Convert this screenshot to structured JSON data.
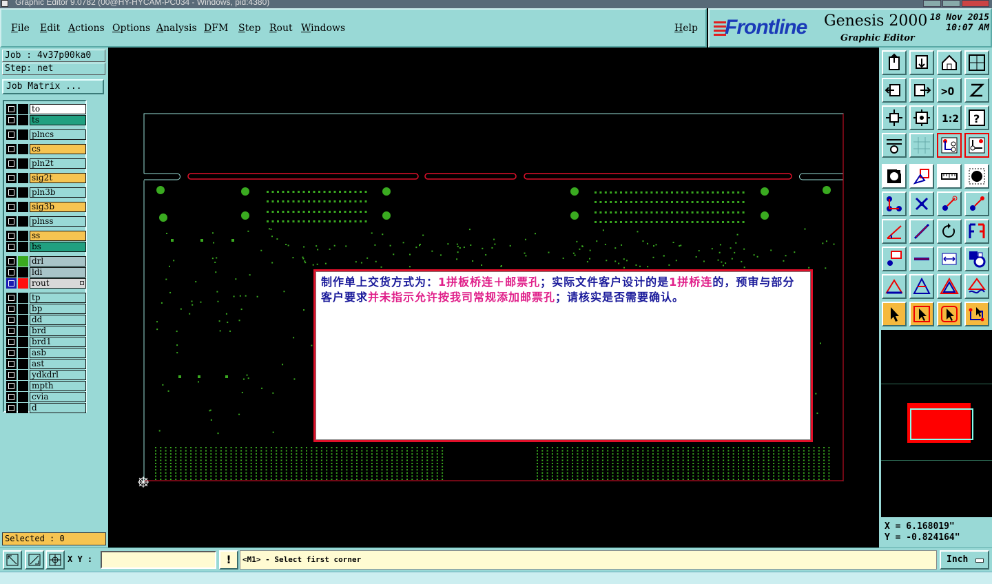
{
  "window": {
    "title": "Graphic Editor 9.0782 (00@HY-HYCAM-PC034 - Windows, pid:4380)"
  },
  "menu": {
    "items": [
      "File",
      "Edit",
      "Actions",
      "Options",
      "Analysis",
      "DFM",
      "Step",
      "Rout",
      "Windows"
    ],
    "help": "Help"
  },
  "logo": {
    "brand": "Frontline",
    "product": "Genesis 2000",
    "subtitle": "Graphic Editor",
    "date": "18 Nov 2015",
    "time": "10:07 AM"
  },
  "job": {
    "job_line": "Job : 4v37p00ka0",
    "step_line": "Step: net",
    "matrix_button": "Job Matrix ..."
  },
  "layers": [
    {
      "name": "to",
      "color": "#ffffff",
      "swatch": "#000000"
    },
    {
      "name": "ts",
      "color": "#20a080",
      "swatch": "#000000"
    },
    {
      "name": "plncs",
      "color": "#99d9d6",
      "swatch": "#000000",
      "gap": true
    },
    {
      "name": "cs",
      "color": "#f6c451",
      "swatch": "#000000",
      "gap": true
    },
    {
      "name": "pln2t",
      "color": "#99d9d6",
      "swatch": "#000000",
      "gap": true
    },
    {
      "name": "sig2t",
      "color": "#f6c451",
      "swatch": "#000000",
      "gap": true
    },
    {
      "name": "pln3b",
      "color": "#99d9d6",
      "swatch": "#000000",
      "gap": true
    },
    {
      "name": "sig3b",
      "color": "#f6c451",
      "swatch": "#000000",
      "gap": true
    },
    {
      "name": "plnss",
      "color": "#99d9d6",
      "swatch": "#000000",
      "gap": true
    },
    {
      "name": "ss",
      "color": "#f6c451",
      "swatch": "#000000",
      "gap": true
    },
    {
      "name": "bs",
      "color": "#20a080",
      "swatch": "#000000"
    },
    {
      "name": "drl",
      "color": "#a8c4c8",
      "swatch": "#3aaa20",
      "gap": true
    },
    {
      "name": "ldi",
      "color": "#a8c4c8",
      "swatch": "#000000"
    },
    {
      "name": "rout",
      "color": "#d8d8d8",
      "swatch": "#ff1010",
      "active": true,
      "mark": true
    },
    {
      "name": "tp",
      "color": "#99d9d6",
      "swatch": "#000000",
      "gap": true
    },
    {
      "name": "bp",
      "color": "#99d9d6",
      "swatch": "#000000"
    },
    {
      "name": "dd",
      "color": "#99d9d6",
      "swatch": "#000000"
    },
    {
      "name": "brd",
      "color": "#99d9d6",
      "swatch": "#000000"
    },
    {
      "name": "brd1",
      "color": "#99d9d6",
      "swatch": "#000000"
    },
    {
      "name": "asb",
      "color": "#99d9d6",
      "swatch": "#000000"
    },
    {
      "name": "ast",
      "color": "#99d9d6",
      "swatch": "#000000"
    },
    {
      "name": "ydkdrl",
      "color": "#99d9d6",
      "swatch": "#000000"
    },
    {
      "name": "mpth",
      "color": "#99d9d6",
      "swatch": "#000000"
    },
    {
      "name": "cvia",
      "color": "#99d9d6",
      "swatch": "#000000"
    },
    {
      "name": "d",
      "color": "#99d9d6",
      "swatch": "#000000"
    }
  ],
  "status": {
    "selected": "Selected : 0"
  },
  "coords": {
    "x": "X  =  6.168019\"",
    "y": "Y  = -0.824164\""
  },
  "bottom": {
    "xy_label": "X Y :",
    "xy_value": "",
    "msg_button": "!",
    "prompt": "<M1> - Select first corner",
    "units": "Inch"
  },
  "message": {
    "segments": [
      {
        "text": "制作单上交货方式为：",
        "color": "blue"
      },
      {
        "text": "1拼板桥连＋邮票孔",
        "color": "pink"
      },
      {
        "text": "；实际文件客户设计的是",
        "color": "blue"
      },
      {
        "text": "1拼桥连",
        "color": "pink"
      },
      {
        "text": "的，预审与部分客户要求",
        "color": "blue"
      },
      {
        "text": "并未指示允许按我司常规添加邮票孔",
        "color": "pink"
      },
      {
        "text": "；请核实是否需要确认。",
        "color": "blue"
      }
    ]
  },
  "colors": {
    "panel": "#99d9d6",
    "board_outline": "#9adfd8",
    "rout": "#e0102a",
    "pads": "#3aaa20",
    "msg_blue": "#1a1a9a",
    "msg_pink": "#e0208a"
  }
}
